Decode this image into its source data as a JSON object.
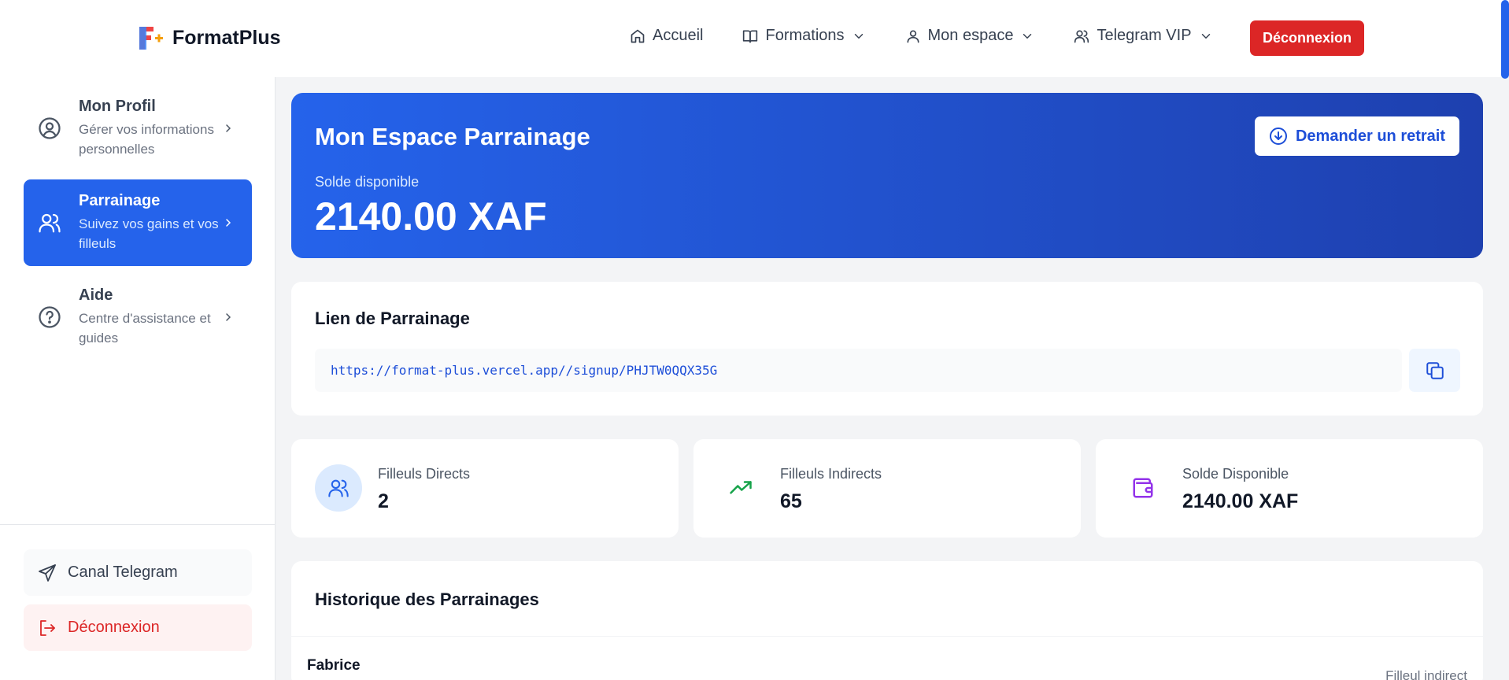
{
  "brand": {
    "name": "FormatPlus"
  },
  "nav": {
    "links": [
      "Accueil",
      "Formations",
      "Mon espace",
      "Telegram VIP"
    ],
    "logout_label": "Déconnexion"
  },
  "sidebar": {
    "items": [
      {
        "title": "Mon Profil",
        "subtitle": "Gérer vos informations personnelles"
      },
      {
        "title": "Parrainage",
        "subtitle": "Suivez vos gains et vos filleuls"
      },
      {
        "title": "Aide",
        "subtitle": "Centre d'assistance et guides"
      }
    ],
    "telegram_label": "Canal Telegram",
    "logout_label": "Déconnexion"
  },
  "hero": {
    "title": "Mon Espace Parrainage",
    "balance_label": "Solde disponible",
    "balance_amount": "2140.00 XAF",
    "withdraw_label": "Demander un retrait"
  },
  "referral": {
    "title": "Lien de Parrainage",
    "link": "https://format-plus.vercel.app//signup/PHJTW0QQX35G"
  },
  "stats": [
    {
      "label": "Filleuls Directs",
      "value": "2"
    },
    {
      "label": "Filleuls Indirects",
      "value": "65"
    },
    {
      "label": "Solde Disponible",
      "value": "2140.00 XAF"
    }
  ],
  "history": {
    "title": "Historique des Parrainages",
    "rows": [
      {
        "name": "Fabrice",
        "type": "Filleul indirect"
      }
    ]
  },
  "colors": {
    "primary": "#2563eb",
    "danger": "#dc2626",
    "success": "#16a34a",
    "purple": "#9333ea"
  }
}
